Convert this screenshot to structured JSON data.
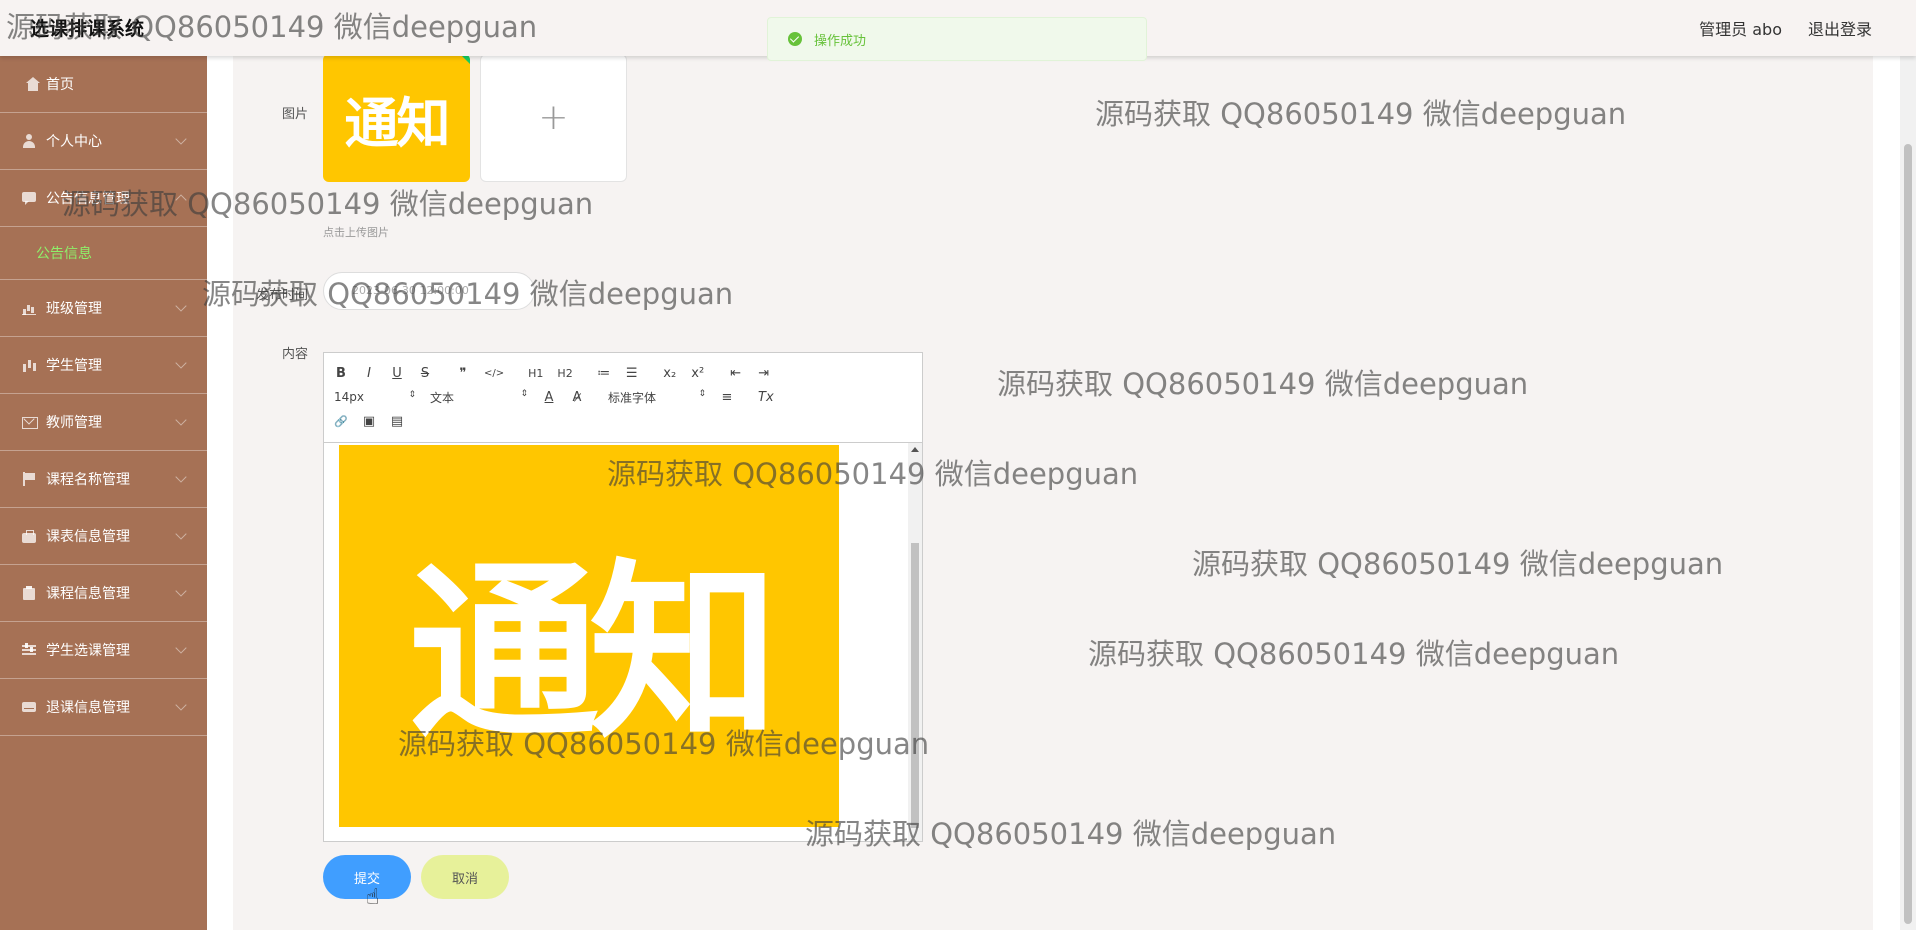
{
  "header": {
    "app_title": "选课排课系统",
    "user_label": "管理员 abo",
    "logout_label": "退出登录"
  },
  "toast": {
    "message": "操作成功"
  },
  "sidebar": {
    "items": [
      {
        "label": "首页",
        "icon": "home-icon"
      },
      {
        "label": "个人中心",
        "icon": "user-icon"
      },
      {
        "label": "公告信息管理",
        "icon": "chat-icon"
      },
      {
        "label": "班级管理",
        "icon": "bar-chart-icon"
      },
      {
        "label": "学生管理",
        "icon": "chart-icon"
      },
      {
        "label": "教师管理",
        "icon": "mail-icon"
      },
      {
        "label": "课程名称管理",
        "icon": "flag-icon"
      },
      {
        "label": "课表信息管理",
        "icon": "briefcase-icon"
      },
      {
        "label": "课程信息管理",
        "icon": "clipboard-icon"
      },
      {
        "label": "学生选课管理",
        "icon": "sliders-icon"
      },
      {
        "label": "退课信息管理",
        "icon": "drive-icon"
      }
    ],
    "active_sub": "公告信息"
  },
  "form": {
    "image_label": "图片",
    "thumb_text": "通知",
    "upload_tip": "点击上传图片",
    "date_label": "发布时间",
    "date_value": "2023-06-30 12:00:00",
    "content_label": "内容",
    "editor_image_text": "通知",
    "submit_label": "提交",
    "cancel_label": "取消"
  },
  "editor_toolbar": {
    "row1": [
      "B",
      "I",
      "U",
      "S",
      "❞",
      "</>",
      "H1",
      "H2",
      "≔",
      "☰",
      "x₂",
      "x²",
      "⇤",
      "⇥"
    ],
    "font_size": "14px",
    "text_type": "文本",
    "font_family": "标准字体",
    "row2_tools": [
      "A",
      "A̷",
      "≡",
      "Tx"
    ],
    "row3": [
      "🔗",
      "▣",
      "▤"
    ]
  },
  "watermarks": [
    "源码获取 QQ86050149 微信deepguan",
    "源码获取 QQ86050149 微信deepguan",
    "源码获取 QQ86050149 微信deepguan",
    "源码获取 QQ86050149 微信deepguan",
    "源码获取 QQ86050149 微信deepguan",
    "源码获取 QQ86050149 微信deepguan",
    "源码获取 QQ86050149 微信deepguan",
    "源码获取 QQ86050149 微信deepguan",
    "源码获取 QQ86050149 微信deepguan",
    "源码获取 QQ86050149 微信deepguan"
  ],
  "colors": {
    "sidebar_bg": "#a67155",
    "active_sub": "#8ff06a",
    "submit_bg": "#409eff",
    "cancel_bg": "#e7f19a",
    "notice_yellow": "#ffc600",
    "toast_green": "#67c23a"
  }
}
